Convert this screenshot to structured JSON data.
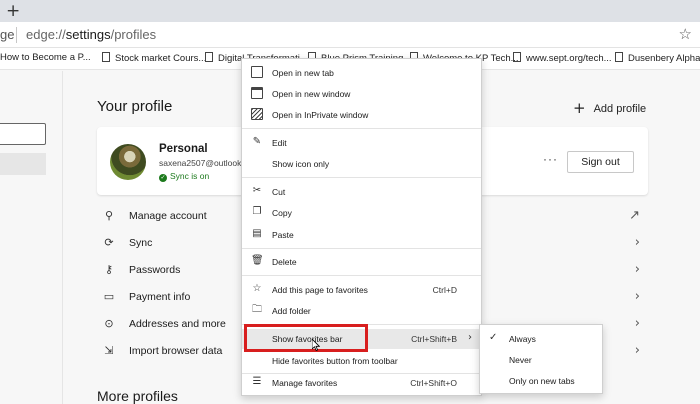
{
  "browser": {
    "new_tab_icon": "plus-icon",
    "address_prefix": "ge",
    "url_host": "edge://",
    "url_bold": "settings",
    "url_path": "/profiles",
    "favorite_star_icon": "star-icon"
  },
  "favorites_bar": [
    {
      "label": "How to Become a P..."
    },
    {
      "label": "Stock market Cours..."
    },
    {
      "label": "Digital Transformati..."
    },
    {
      "label": "Blue Prism Training..."
    },
    {
      "label": "Welcome to KP Tech..."
    },
    {
      "label": "www.sept.org/tech..."
    },
    {
      "label": "Dusenbery Alpha S..."
    }
  ],
  "profile": {
    "heading": "Your profile",
    "add_profile": "Add profile",
    "name": "Personal",
    "email": "saxena2507@outlook.co",
    "sync": "Sync is on",
    "more": "···",
    "sign_out": "Sign out"
  },
  "settings_rows": [
    {
      "label": "Manage account",
      "icon": "person-icon",
      "trail": "↗"
    },
    {
      "label": "Sync",
      "icon": "sync-icon",
      "trail": "›"
    },
    {
      "label": "Passwords",
      "icon": "key-icon",
      "trail": "›"
    },
    {
      "label": "Payment info",
      "icon": "card-icon",
      "trail": "›"
    },
    {
      "label": "Addresses and more",
      "icon": "location-icon",
      "trail": "›"
    },
    {
      "label": "Import browser data",
      "icon": "import-icon",
      "trail": "›"
    }
  ],
  "more_profiles": "More profiles",
  "context_menu": {
    "open_new_tab": "Open in new tab",
    "open_new_window": "Open in new window",
    "open_inprivate": "Open in InPrivate window",
    "edit": "Edit",
    "show_icon_only": "Show icon only",
    "cut": "Cut",
    "copy": "Copy",
    "paste": "Paste",
    "delete": "Delete",
    "add_page": "Add this page to favorites",
    "add_page_shortcut": "Ctrl+D",
    "add_folder": "Add folder",
    "show_fav_bar": "Show favorites bar",
    "show_fav_bar_shortcut": "Ctrl+Shift+B",
    "hide_fav_button": "Hide favorites button from toolbar",
    "manage_favorites": "Manage favorites",
    "manage_favorites_shortcut": "Ctrl+Shift+O"
  },
  "submenu": {
    "always": "Always",
    "never": "Never",
    "new_tabs_only": "Only on new tabs",
    "checked": "Always"
  },
  "colors": {
    "highlight_box": "#d81e1e",
    "sync_green": "#1d7a1d"
  }
}
